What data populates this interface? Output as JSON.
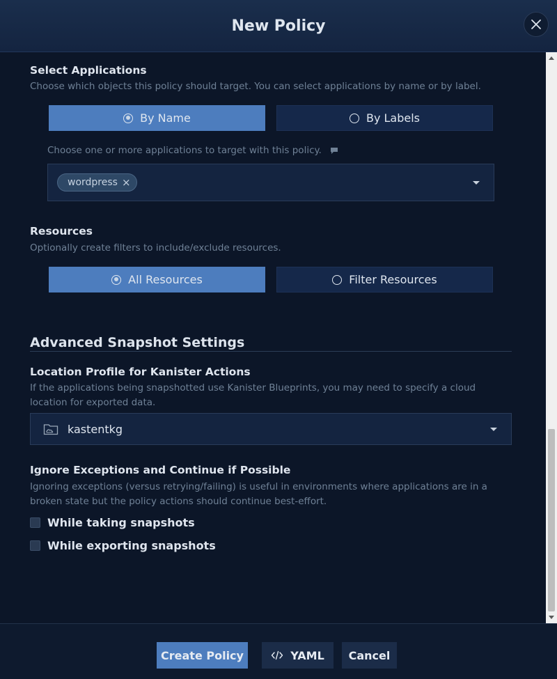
{
  "header": {
    "title": "New Policy"
  },
  "select_applications": {
    "title": "Select Applications",
    "description": "Choose which objects this policy should target. You can select applications by name or by label.",
    "options": [
      "By Name",
      "By Labels"
    ],
    "selected": "By Name",
    "hint": "Choose one or more applications to target with this policy.",
    "tags": [
      "wordpress"
    ]
  },
  "resources": {
    "title": "Resources",
    "description": "Optionally create filters to include/exclude resources.",
    "options": [
      "All Resources",
      "Filter Resources"
    ],
    "selected": "All Resources"
  },
  "advanced": {
    "title": "Advanced Snapshot Settings",
    "location_profile": {
      "title": "Location Profile for Kanister Actions",
      "description_line1": "If the applications being snapshotted use Kanister Blueprints, you may need to specify a cloud",
      "description_line2": "location for exported data.",
      "value": "kastentkg"
    },
    "ignore_exceptions": {
      "title": "Ignore Exceptions and Continue if Possible",
      "description_line1": "Ignoring exceptions (versus retrying/failing) is useful in environments where applications are in a",
      "description_line2": "broken state but the policy actions should continue best-effort.",
      "options": [
        {
          "label": "While taking snapshots",
          "checked": false
        },
        {
          "label": "While exporting snapshots",
          "checked": false
        }
      ]
    }
  },
  "footer": {
    "create_label": "Create Policy",
    "yaml_label": "YAML",
    "cancel_label": "Cancel"
  },
  "colors": {
    "accent": "#4d7dbe",
    "background": "#0c1628",
    "header": "#17294a"
  }
}
